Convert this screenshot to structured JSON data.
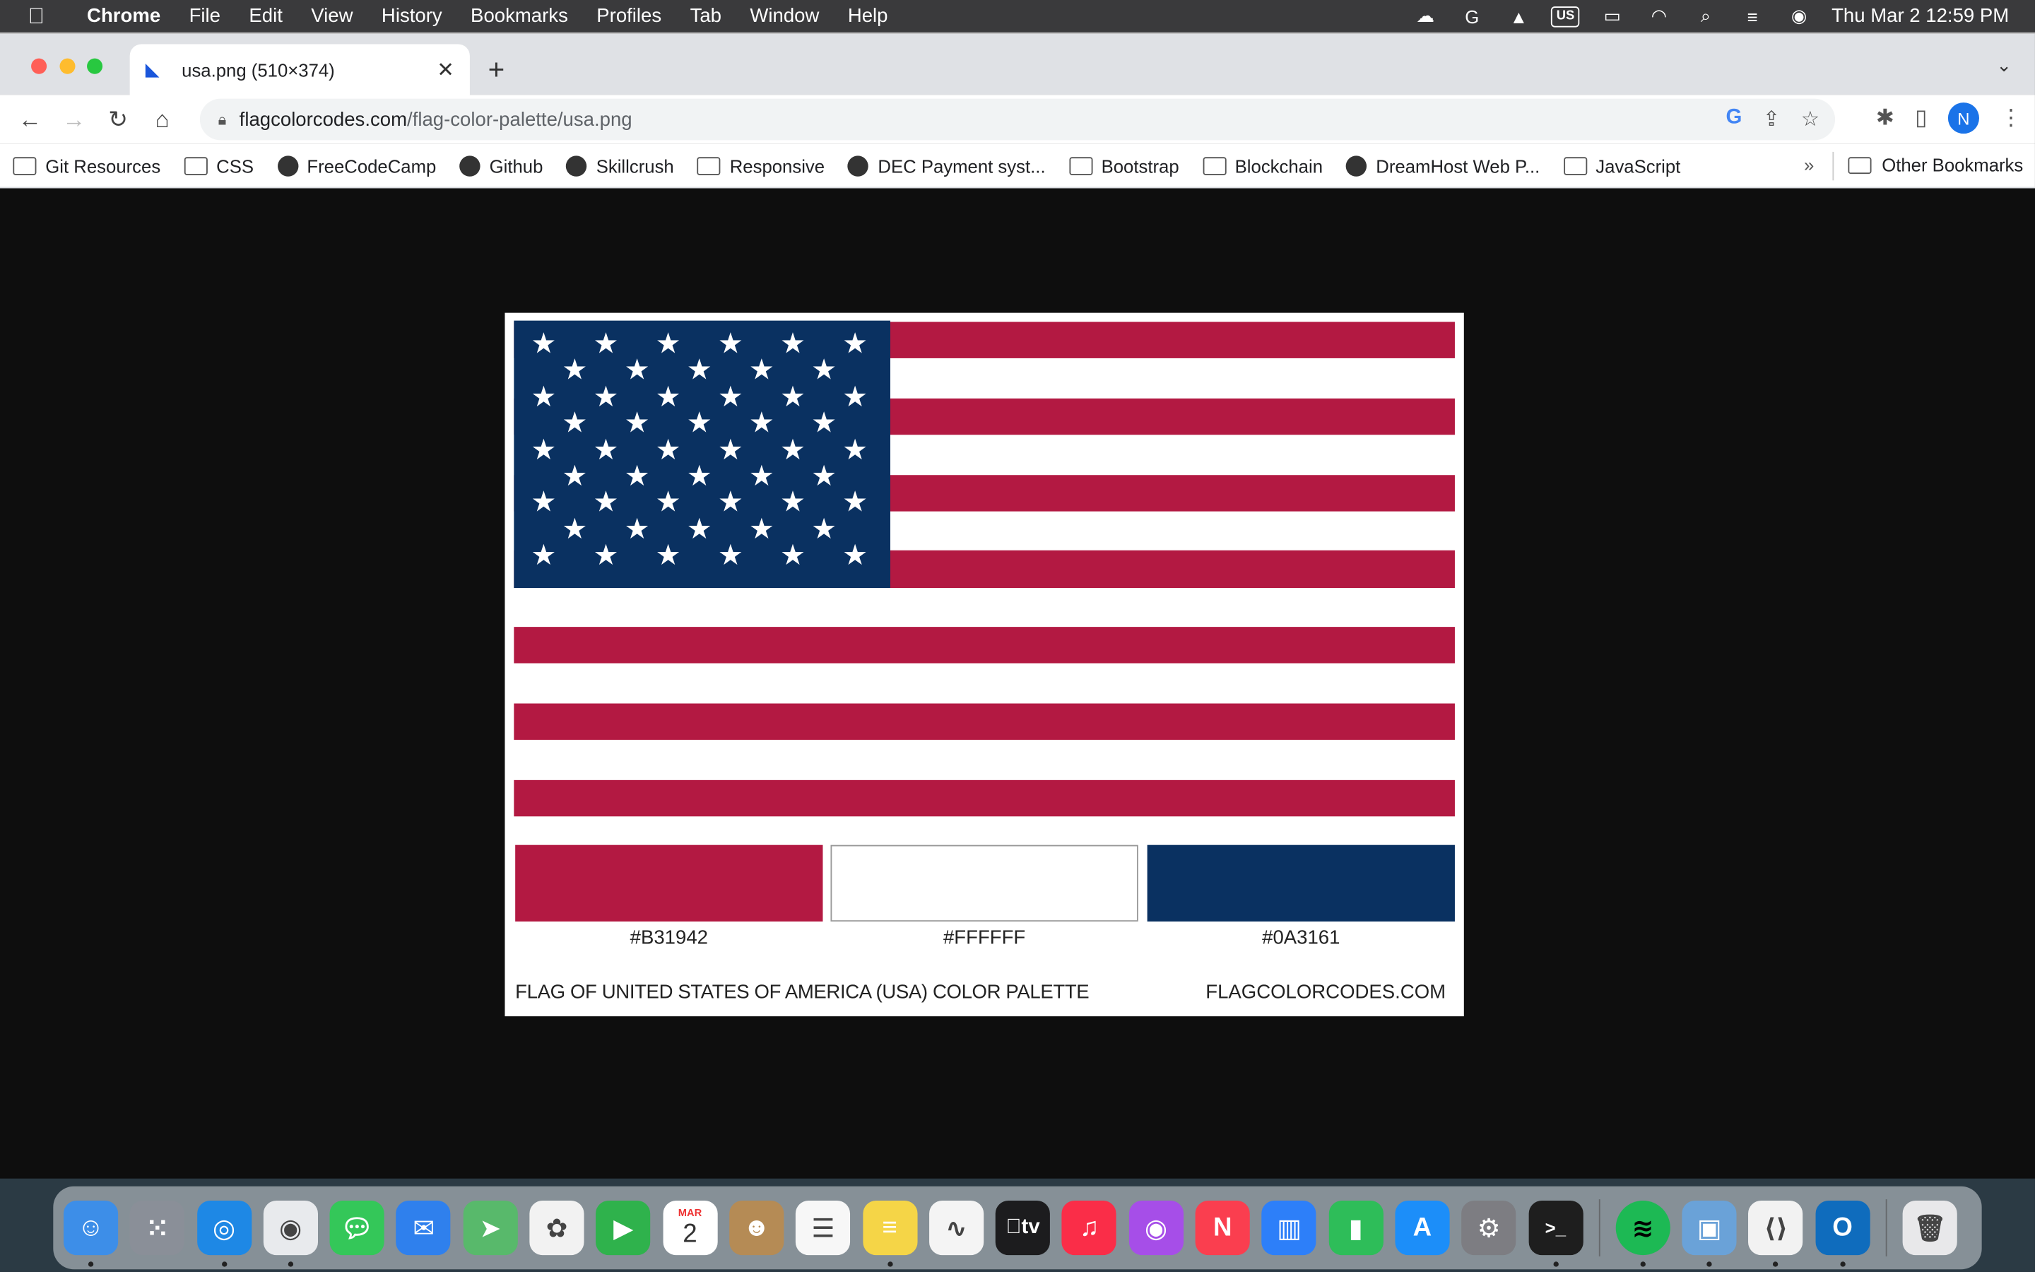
{
  "menubar": {
    "app_name": "Chrome",
    "items": [
      "File",
      "Edit",
      "View",
      "History",
      "Bookmarks",
      "Profiles",
      "Tab",
      "Window",
      "Help"
    ],
    "input_source": "US",
    "datetime": "Thu Mar 2  12:59 PM"
  },
  "browser": {
    "tab_title": "usa.png (510×374)",
    "url_domain": "flagcolorcodes.com",
    "url_path": "/flag-color-palette/usa.png",
    "profile_initial": "N"
  },
  "bookmarks": [
    {
      "label": "Git Resources",
      "icon": "folder-icon"
    },
    {
      "label": "CSS",
      "icon": "folder-icon"
    },
    {
      "label": "FreeCodeCamp",
      "icon": "freecodecamp-icon"
    },
    {
      "label": "Github",
      "icon": "github-icon"
    },
    {
      "label": "Skillcrush",
      "icon": "skillcrush-icon"
    },
    {
      "label": "Responsive",
      "icon": "folder-icon"
    },
    {
      "label": "DEC Payment syst...",
      "icon": "globe-icon"
    },
    {
      "label": "Bootstrap",
      "icon": "folder-icon"
    },
    {
      "label": "Blockchain",
      "icon": "folder-icon"
    },
    {
      "label": "DreamHost Web P...",
      "icon": "dreamhost-icon"
    },
    {
      "label": "JavaScript",
      "icon": "folder-icon"
    }
  ],
  "bookmarks_overflow": "»",
  "other_bookmarks": "Other Bookmarks",
  "palette": {
    "colors": {
      "red": "#B31942",
      "white": "#FFFFFF",
      "blue": "#0A3161"
    },
    "swatches": [
      {
        "hex": "#B31942",
        "label": "#B31942"
      },
      {
        "hex": "#FFFFFF",
        "label": "#FFFFFF"
      },
      {
        "hex": "#0A3161",
        "label": "#0A3161"
      }
    ],
    "footer_left": "FLAG OF UNITED STATES OF AMERICA (USA) COLOR PALETTE",
    "footer_right": "FLAGCOLORCODES.COM"
  },
  "dock": {
    "calendar_month": "MAR",
    "calendar_day": "2",
    "tv_label": "tv",
    "apps": [
      "finder",
      "launchpad",
      "safari",
      "chrome",
      "messages",
      "mail",
      "maps",
      "photos",
      "facetime",
      "calendar",
      "contacts",
      "reminders",
      "notes",
      "freeform",
      "tv",
      "music",
      "podcasts",
      "news",
      "keynote",
      "numbers",
      "app-store",
      "system-settings",
      "terminal",
      "spotify",
      "preview",
      "vscode",
      "outlook",
      "trash"
    ]
  }
}
